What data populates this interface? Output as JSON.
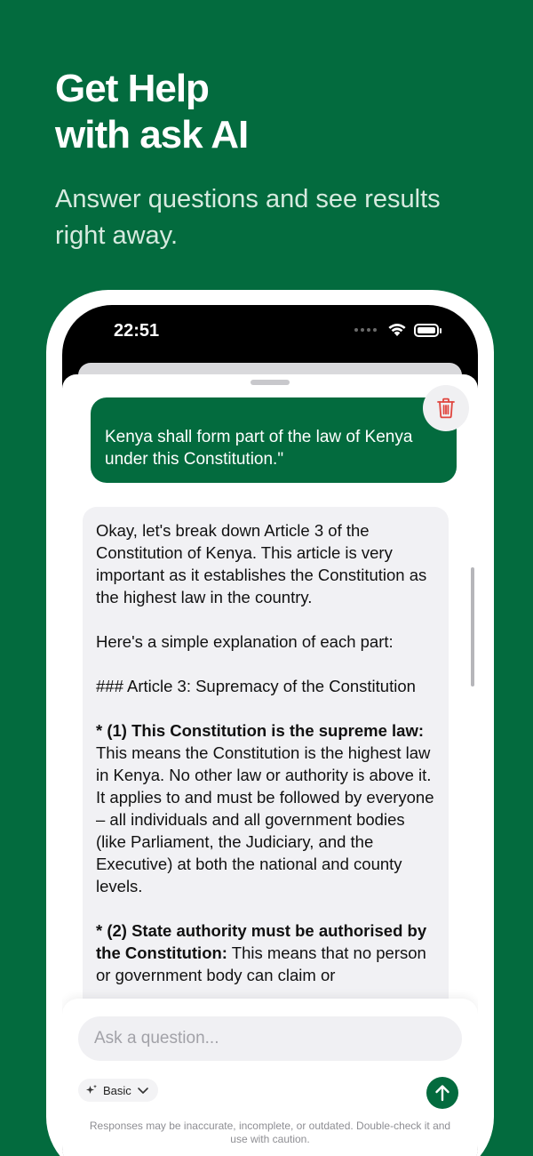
{
  "promo": {
    "title_line1": "Get Help",
    "title_line2": "with ask AI",
    "subtitle": "Answer questions and see results right away."
  },
  "status_bar": {
    "time": "22:51"
  },
  "chat": {
    "user_message_line1": "Kenya shall form part of the law of Kenya",
    "user_message_line2": "under this Constitution.\"",
    "ai_intro": "Okay, let's break down Article 3 of the Constitution of Kenya. This article is very important as it establishes the Constitution as the highest law in the country.",
    "ai_lead": "Here's a simple explanation of each part:",
    "ai_heading": "### Article 3: Supremacy of the Constitution",
    "point1_title": "* (1) This Constitution is the supreme law:",
    "point1_body": "This means the Constitution is the highest law in Kenya. No other law or authority is above it. It applies to and must be followed by everyone – all individuals and all government bodies (like Parliament, the Judiciary, and the Executive) at both the national and county levels.",
    "point2_title": "* (2) State authority must be authorised by the Constitution:",
    "point2_body": "This means that no person or government body can claim or"
  },
  "input": {
    "placeholder": "Ask a question...",
    "mode_label": "Basic",
    "disclaimer": "Responses may be inaccurate, incomplete, or outdated. Double-check it and use with caution."
  },
  "icons": {
    "trash": "trash-icon",
    "send": "arrow-up-icon",
    "sparkle": "sparkle-icon",
    "chevron": "chevron-down-icon",
    "wifi": "wifi-icon",
    "battery": "battery-icon",
    "signal": "signal-icon"
  },
  "colors": {
    "brand_green": "#036b3e",
    "delete_red": "#e0463f",
    "bubble_gray": "#f1f1f4"
  }
}
